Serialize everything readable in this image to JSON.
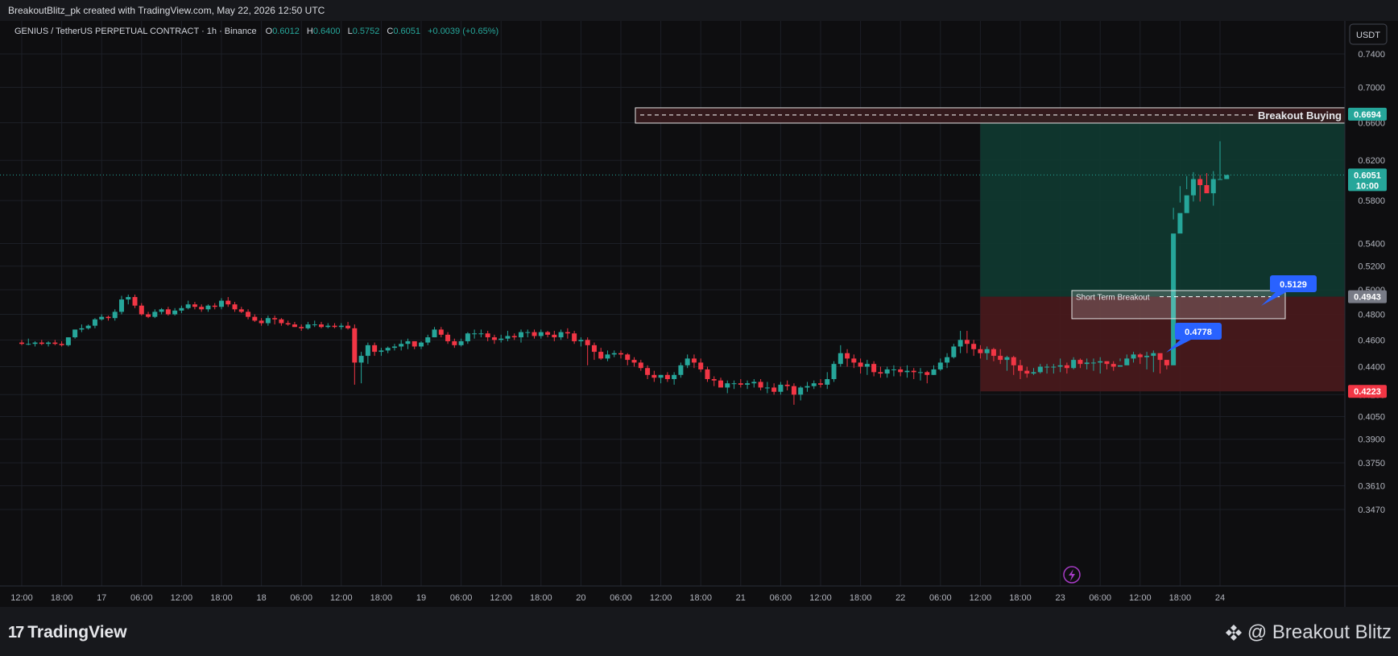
{
  "header": {
    "attribution": "BreakoutBlitz_pk created with TradingView.com, May 22, 2026 12:50 UTC"
  },
  "legend": {
    "symbol": "GENIUS / TetherUS PERPETUAL CONTRACT · 1h · Binance",
    "o_label": "O",
    "o_value": "0.6012",
    "h_label": "H",
    "h_value": "0.6400",
    "l_label": "L",
    "l_value": "0.5752",
    "c_label": "C",
    "c_value": "0.6051",
    "change": "+0.0039 (+0.65%)"
  },
  "currency_button": "USDT",
  "branding": {
    "logo_mark": "17",
    "logo_text": "TradingView",
    "watermark": "@ Breakout Blitz"
  },
  "colors": {
    "up": "#26a69a",
    "down": "#f23645",
    "background": "#0e0e10",
    "profit_zone": "#0f3a31",
    "loss_zone": "#4a1a1d",
    "label_blue": "#2962ff"
  },
  "chart_data": {
    "type": "candlestick",
    "y_scale": "log",
    "ylim": [
      0.347,
      0.74
    ],
    "y_ticks": [
      "0.7400",
      "0.7000",
      "0.6600",
      "0.6200",
      "0.5800",
      "0.5400",
      "0.5200",
      "0.5000",
      "0.4800",
      "0.4600",
      "0.4400",
      "0.4200",
      "0.4050",
      "0.3900",
      "0.3750",
      "0.3610",
      "0.3470"
    ],
    "x_ticks": [
      "12:00",
      "18:00",
      "17",
      "06:00",
      "12:00",
      "18:00",
      "18",
      "06:00",
      "12:00",
      "18:00",
      "19",
      "06:00",
      "12:00",
      "18:00",
      "20",
      "06:00",
      "12:00",
      "18:00",
      "21",
      "06:00",
      "12:00",
      "18:00",
      "22",
      "06:00",
      "12:00",
      "18:00",
      "23",
      "06:00",
      "12:00",
      "18:00",
      "24"
    ],
    "x_range": [
      "2026-05-16 12:00",
      "2026-05-24 00:00"
    ],
    "price_labels": [
      {
        "text": "0.6694",
        "kind": "target"
      },
      {
        "text": "0.6051",
        "kind": "last",
        "countdown": "10:00"
      },
      {
        "text": "0.4943",
        "kind": "entry"
      },
      {
        "text": "0.4223",
        "kind": "stop"
      }
    ],
    "annotations": [
      {
        "text": "Breakout Buying",
        "price": 0.6694
      },
      {
        "text": "Short Term Breakout",
        "price": 0.4943
      },
      {
        "text": "0.5129",
        "price": 0.5129
      },
      {
        "text": "0.4778",
        "price": 0.4778
      }
    ],
    "position": {
      "entry": 0.4943,
      "target": 0.6694,
      "stop": 0.4223,
      "start": "2026-05-22 12:00"
    },
    "ohlc_series": {
      "start": "2026-05-16 12:00",
      "interval": "1h",
      "o": [
        0.458,
        0.457,
        0.457,
        0.458,
        0.457,
        0.458,
        0.457,
        0.456,
        0.462,
        0.468,
        0.469,
        0.471,
        0.476,
        0.478,
        0.477,
        0.482,
        0.492,
        0.494,
        0.487,
        0.48,
        0.478,
        0.482,
        0.484,
        0.48,
        0.483,
        0.485,
        0.488,
        0.486,
        0.484,
        0.487,
        0.486,
        0.491,
        0.488,
        0.484,
        0.482,
        0.478,
        0.475,
        0.473,
        0.477,
        0.476,
        0.473,
        0.472,
        0.47,
        0.469,
        0.472,
        0.472,
        0.47,
        0.471,
        0.47,
        0.471,
        0.469,
        0.443,
        0.448,
        0.456,
        0.451,
        0.452,
        0.454,
        0.455,
        0.457,
        0.459,
        0.455,
        0.458,
        0.462,
        0.468,
        0.464,
        0.459,
        0.456,
        0.459,
        0.465,
        0.465,
        0.465,
        0.462,
        0.46,
        0.461,
        0.463,
        0.462,
        0.466,
        0.466,
        0.463,
        0.466,
        0.464,
        0.462,
        0.466,
        0.465,
        0.459,
        0.46,
        0.456,
        0.451,
        0.446,
        0.449,
        0.45,
        0.449,
        0.445,
        0.443,
        0.439,
        0.434,
        0.432,
        0.434,
        0.431,
        0.434,
        0.441,
        0.446,
        0.443,
        0.438,
        0.431,
        0.43,
        0.425,
        0.428,
        0.428,
        0.427,
        0.428,
        0.429,
        0.425,
        0.425,
        0.422,
        0.427,
        0.426,
        0.42,
        0.425,
        0.426,
        0.428,
        0.427,
        0.431,
        0.442,
        0.45,
        0.446,
        0.443,
        0.44,
        0.442,
        0.436,
        0.435,
        0.438,
        0.438,
        0.436,
        0.437,
        0.436,
        0.436,
        0.434,
        0.438,
        0.443,
        0.447,
        0.455,
        0.46,
        0.457,
        0.453,
        0.45,
        0.453,
        0.448,
        0.445,
        0.447,
        0.441,
        0.437,
        0.435,
        0.436,
        0.44,
        0.44,
        0.44,
        0.441,
        0.439,
        0.445,
        0.442,
        0.443,
        0.443,
        0.444,
        0.442,
        0.44,
        0.441,
        0.446,
        0.449,
        0.447,
        0.448,
        0.45,
        0.445,
        0.441,
        0.549,
        0.568,
        0.585,
        0.601,
        0.595,
        0.587,
        0.601,
        0.601
      ],
      "h": [
        0.46,
        0.461,
        0.459,
        0.46,
        0.459,
        0.46,
        0.459,
        0.462,
        0.468,
        0.472,
        0.472,
        0.477,
        0.48,
        0.479,
        0.484,
        0.495,
        0.496,
        0.496,
        0.489,
        0.482,
        0.484,
        0.485,
        0.486,
        0.485,
        0.487,
        0.491,
        0.49,
        0.488,
        0.488,
        0.489,
        0.493,
        0.494,
        0.49,
        0.486,
        0.484,
        0.48,
        0.477,
        0.479,
        0.479,
        0.477,
        0.475,
        0.474,
        0.472,
        0.474,
        0.475,
        0.474,
        0.473,
        0.473,
        0.473,
        0.474,
        0.472,
        0.451,
        0.458,
        0.458,
        0.454,
        0.455,
        0.457,
        0.46,
        0.461,
        0.459,
        0.459,
        0.464,
        0.47,
        0.47,
        0.466,
        0.461,
        0.461,
        0.466,
        0.468,
        0.468,
        0.467,
        0.464,
        0.464,
        0.467,
        0.465,
        0.468,
        0.468,
        0.468,
        0.468,
        0.467,
        0.467,
        0.468,
        0.469,
        0.467,
        0.462,
        0.462,
        0.458,
        0.454,
        0.452,
        0.452,
        0.452,
        0.45,
        0.447,
        0.445,
        0.441,
        0.437,
        0.434,
        0.436,
        0.436,
        0.443,
        0.449,
        0.449,
        0.446,
        0.44,
        0.433,
        0.432,
        0.43,
        0.43,
        0.431,
        0.43,
        0.431,
        0.431,
        0.429,
        0.428,
        0.429,
        0.43,
        0.428,
        0.426,
        0.429,
        0.43,
        0.431,
        0.436,
        0.444,
        0.456,
        0.453,
        0.449,
        0.446,
        0.445,
        0.444,
        0.44,
        0.44,
        0.441,
        0.44,
        0.441,
        0.439,
        0.439,
        0.437,
        0.441,
        0.446,
        0.45,
        0.457,
        0.467,
        0.467,
        0.46,
        0.456,
        0.455,
        0.454,
        0.453,
        0.448,
        0.448,
        0.445,
        0.44,
        0.439,
        0.442,
        0.442,
        0.442,
        0.446,
        0.443,
        0.447,
        0.446,
        0.446,
        0.446,
        0.447,
        0.444,
        0.444,
        0.446,
        0.449,
        0.451,
        0.45,
        0.451,
        0.452,
        0.449,
        0.443,
        0.573,
        0.594,
        0.604,
        0.608,
        0.605,
        0.607,
        0.609,
        0.64
      ],
      "l": [
        0.456,
        0.456,
        0.455,
        0.456,
        0.455,
        0.456,
        0.455,
        0.455,
        0.461,
        0.466,
        0.468,
        0.469,
        0.475,
        0.475,
        0.475,
        0.48,
        0.488,
        0.485,
        0.479,
        0.477,
        0.477,
        0.48,
        0.479,
        0.479,
        0.481,
        0.484,
        0.484,
        0.482,
        0.482,
        0.484,
        0.484,
        0.486,
        0.482,
        0.481,
        0.476,
        0.474,
        0.471,
        0.471,
        0.472,
        0.471,
        0.471,
        0.47,
        0.467,
        0.468,
        0.47,
        0.469,
        0.469,
        0.469,
        0.468,
        0.468,
        0.427,
        0.428,
        0.442,
        0.448,
        0.448,
        0.45,
        0.452,
        0.452,
        0.453,
        0.453,
        0.453,
        0.456,
        0.462,
        0.462,
        0.457,
        0.454,
        0.455,
        0.457,
        0.461,
        0.462,
        0.459,
        0.457,
        0.458,
        0.459,
        0.46,
        0.458,
        0.462,
        0.461,
        0.461,
        0.462,
        0.459,
        0.46,
        0.461,
        0.457,
        0.455,
        0.441,
        0.445,
        0.445,
        0.444,
        0.447,
        0.446,
        0.441,
        0.44,
        0.437,
        0.431,
        0.429,
        0.428,
        0.429,
        0.427,
        0.432,
        0.439,
        0.439,
        0.436,
        0.429,
        0.426,
        0.426,
        0.421,
        0.424,
        0.425,
        0.424,
        0.425,
        0.423,
        0.421,
        0.42,
        0.42,
        0.423,
        0.413,
        0.416,
        0.422,
        0.424,
        0.425,
        0.424,
        0.429,
        0.44,
        0.44,
        0.439,
        0.435,
        0.434,
        0.433,
        0.432,
        0.432,
        0.433,
        0.433,
        0.432,
        0.431,
        0.43,
        0.428,
        0.434,
        0.437,
        0.439,
        0.446,
        0.45,
        0.45,
        0.448,
        0.446,
        0.445,
        0.444,
        0.442,
        0.437,
        0.434,
        0.431,
        0.432,
        0.434,
        0.435,
        0.435,
        0.435,
        0.436,
        0.435,
        0.438,
        0.439,
        0.438,
        0.437,
        0.435,
        0.438,
        0.437,
        0.444,
        0.445,
        0.443,
        0.442,
        0.438,
        0.436,
        0.435,
        0.438,
        0.562,
        0.578,
        0.591,
        0.579,
        0.579,
        0.591,
        0.575
      ],
      "c": [
        0.457,
        0.457,
        0.458,
        0.457,
        0.458,
        0.457,
        0.456,
        0.462,
        0.468,
        0.469,
        0.471,
        0.476,
        0.478,
        0.477,
        0.482,
        0.492,
        0.494,
        0.487,
        0.48,
        0.478,
        0.482,
        0.484,
        0.48,
        0.483,
        0.485,
        0.488,
        0.486,
        0.484,
        0.487,
        0.486,
        0.491,
        0.488,
        0.484,
        0.482,
        0.478,
        0.475,
        0.473,
        0.477,
        0.476,
        0.473,
        0.472,
        0.47,
        0.469,
        0.472,
        0.472,
        0.47,
        0.471,
        0.47,
        0.471,
        0.469,
        0.443,
        0.448,
        0.456,
        0.451,
        0.452,
        0.454,
        0.455,
        0.457,
        0.459,
        0.455,
        0.458,
        0.462,
        0.468,
        0.464,
        0.459,
        0.456,
        0.459,
        0.465,
        0.465,
        0.465,
        0.462,
        0.46,
        0.461,
        0.463,
        0.462,
        0.466,
        0.466,
        0.463,
        0.466,
        0.464,
        0.462,
        0.466,
        0.465,
        0.459,
        0.46,
        0.456,
        0.451,
        0.446,
        0.449,
        0.45,
        0.449,
        0.445,
        0.443,
        0.439,
        0.434,
        0.432,
        0.434,
        0.431,
        0.434,
        0.441,
        0.446,
        0.443,
        0.438,
        0.431,
        0.43,
        0.425,
        0.428,
        0.428,
        0.427,
        0.428,
        0.429,
        0.425,
        0.425,
        0.422,
        0.427,
        0.426,
        0.42,
        0.425,
        0.426,
        0.428,
        0.427,
        0.431,
        0.442,
        0.45,
        0.446,
        0.443,
        0.44,
        0.442,
        0.436,
        0.435,
        0.438,
        0.438,
        0.436,
        0.437,
        0.436,
        0.436,
        0.434,
        0.438,
        0.443,
        0.447,
        0.455,
        0.46,
        0.457,
        0.453,
        0.45,
        0.453,
        0.448,
        0.445,
        0.447,
        0.441,
        0.437,
        0.435,
        0.436,
        0.44,
        0.44,
        0.44,
        0.441,
        0.439,
        0.445,
        0.442,
        0.443,
        0.443,
        0.444,
        0.442,
        0.44,
        0.441,
        0.446,
        0.449,
        0.447,
        0.448,
        0.45,
        0.445,
        0.441,
        0.549,
        0.568,
        0.585,
        0.601,
        0.595,
        0.587,
        0.601,
        0.601,
        0.6051
      ]
    }
  }
}
